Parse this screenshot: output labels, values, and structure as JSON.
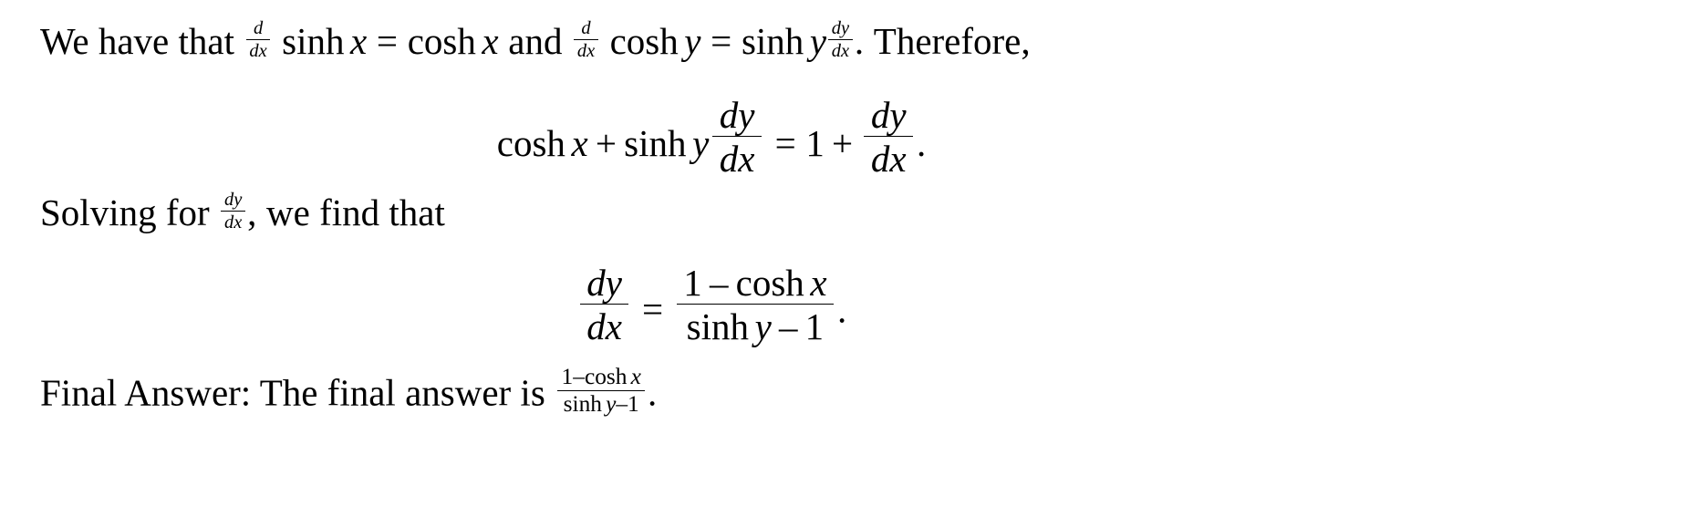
{
  "document": {
    "kind": "math-solution",
    "background_color": "#ffffff",
    "text_color": "#000000"
  },
  "paragraph1": {
    "lead": "We have that",
    "d": "d",
    "dx": "dx",
    "sinh": "sinh",
    "x": "x",
    "equals": "=",
    "cosh": "cosh",
    "and": "and",
    "cosh2": "cosh",
    "y": "y",
    "equals2": "=",
    "sinh2": "sinh",
    "y2": "y",
    "dy": "dy",
    "dx2": "dx",
    "period": ".",
    "therefore": "Therefore,"
  },
  "equation1": {
    "cosh": "cosh",
    "x": "x",
    "plus": "+",
    "sinh": "sinh",
    "y": "y",
    "dy": "dy",
    "dx": "dx",
    "equals": "=",
    "one": "1",
    "plus2": "+",
    "dy2": "dy",
    "dx2": "dx",
    "period": "."
  },
  "paragraph2": {
    "lead": "Solving for",
    "dy": "dy",
    "dx": "dx",
    "comma": ",",
    "tail": "we find that"
  },
  "equation2": {
    "dy": "dy",
    "dx": "dx",
    "equals": "=",
    "one": "1",
    "minus": "–",
    "cosh": "cosh",
    "x": "x",
    "sinh": "sinh",
    "y": "y",
    "minus2": "–",
    "one2": "1",
    "period": "."
  },
  "paragraph3": {
    "label": "Final Answer: The final answer is",
    "one": "1",
    "minus": "–",
    "cosh": "cosh",
    "x": "x",
    "sinh": "sinh",
    "y": "y",
    "minus2": "–",
    "one2": "1",
    "period": "."
  }
}
